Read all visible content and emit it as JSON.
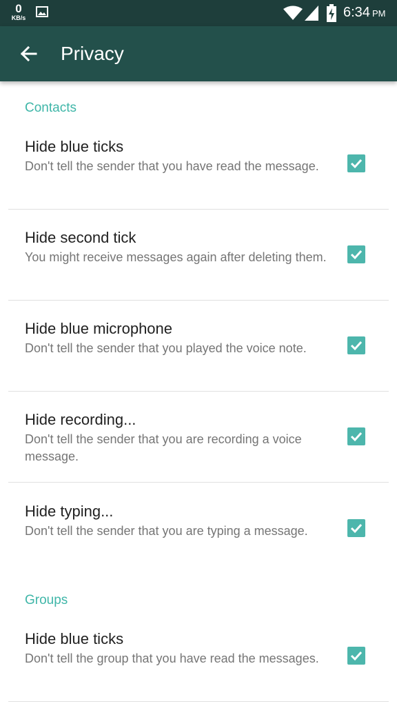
{
  "status_bar": {
    "speed_value": "0",
    "speed_unit": "KB/s",
    "time": "6:34",
    "ampm": "PM",
    "icons": [
      "image-icon",
      "wifi-icon",
      "signal-icon",
      "battery-charging-icon"
    ]
  },
  "app_bar": {
    "title": "Privacy",
    "back_icon": "arrow-back-icon"
  },
  "colors": {
    "status_bar": "#1e3e3b",
    "app_bar": "#23504b",
    "accent": "#3fb6a8",
    "checkbox": "#4db6ac"
  },
  "sections": [
    {
      "header": "Contacts",
      "items": [
        {
          "title": "Hide blue ticks",
          "subtitle": "Don't tell the sender that you have read the message.",
          "checked": true
        },
        {
          "title": "Hide second tick",
          "subtitle": "You might receive messages again after deleting them.",
          "checked": true
        },
        {
          "title": "Hide blue microphone",
          "subtitle": "Don't tell the sender that you played the voice note.",
          "checked": true
        },
        {
          "title": "Hide recording...",
          "subtitle": "Don't tell the sender that you are recording a voice message.",
          "checked": true
        },
        {
          "title": "Hide typing...",
          "subtitle": "Don't tell the sender that you are typing a message.",
          "checked": true
        }
      ]
    },
    {
      "header": "Groups",
      "items": [
        {
          "title": "Hide blue ticks",
          "subtitle": "Don't tell the group that you have read the messages.",
          "checked": true
        }
      ]
    }
  ]
}
